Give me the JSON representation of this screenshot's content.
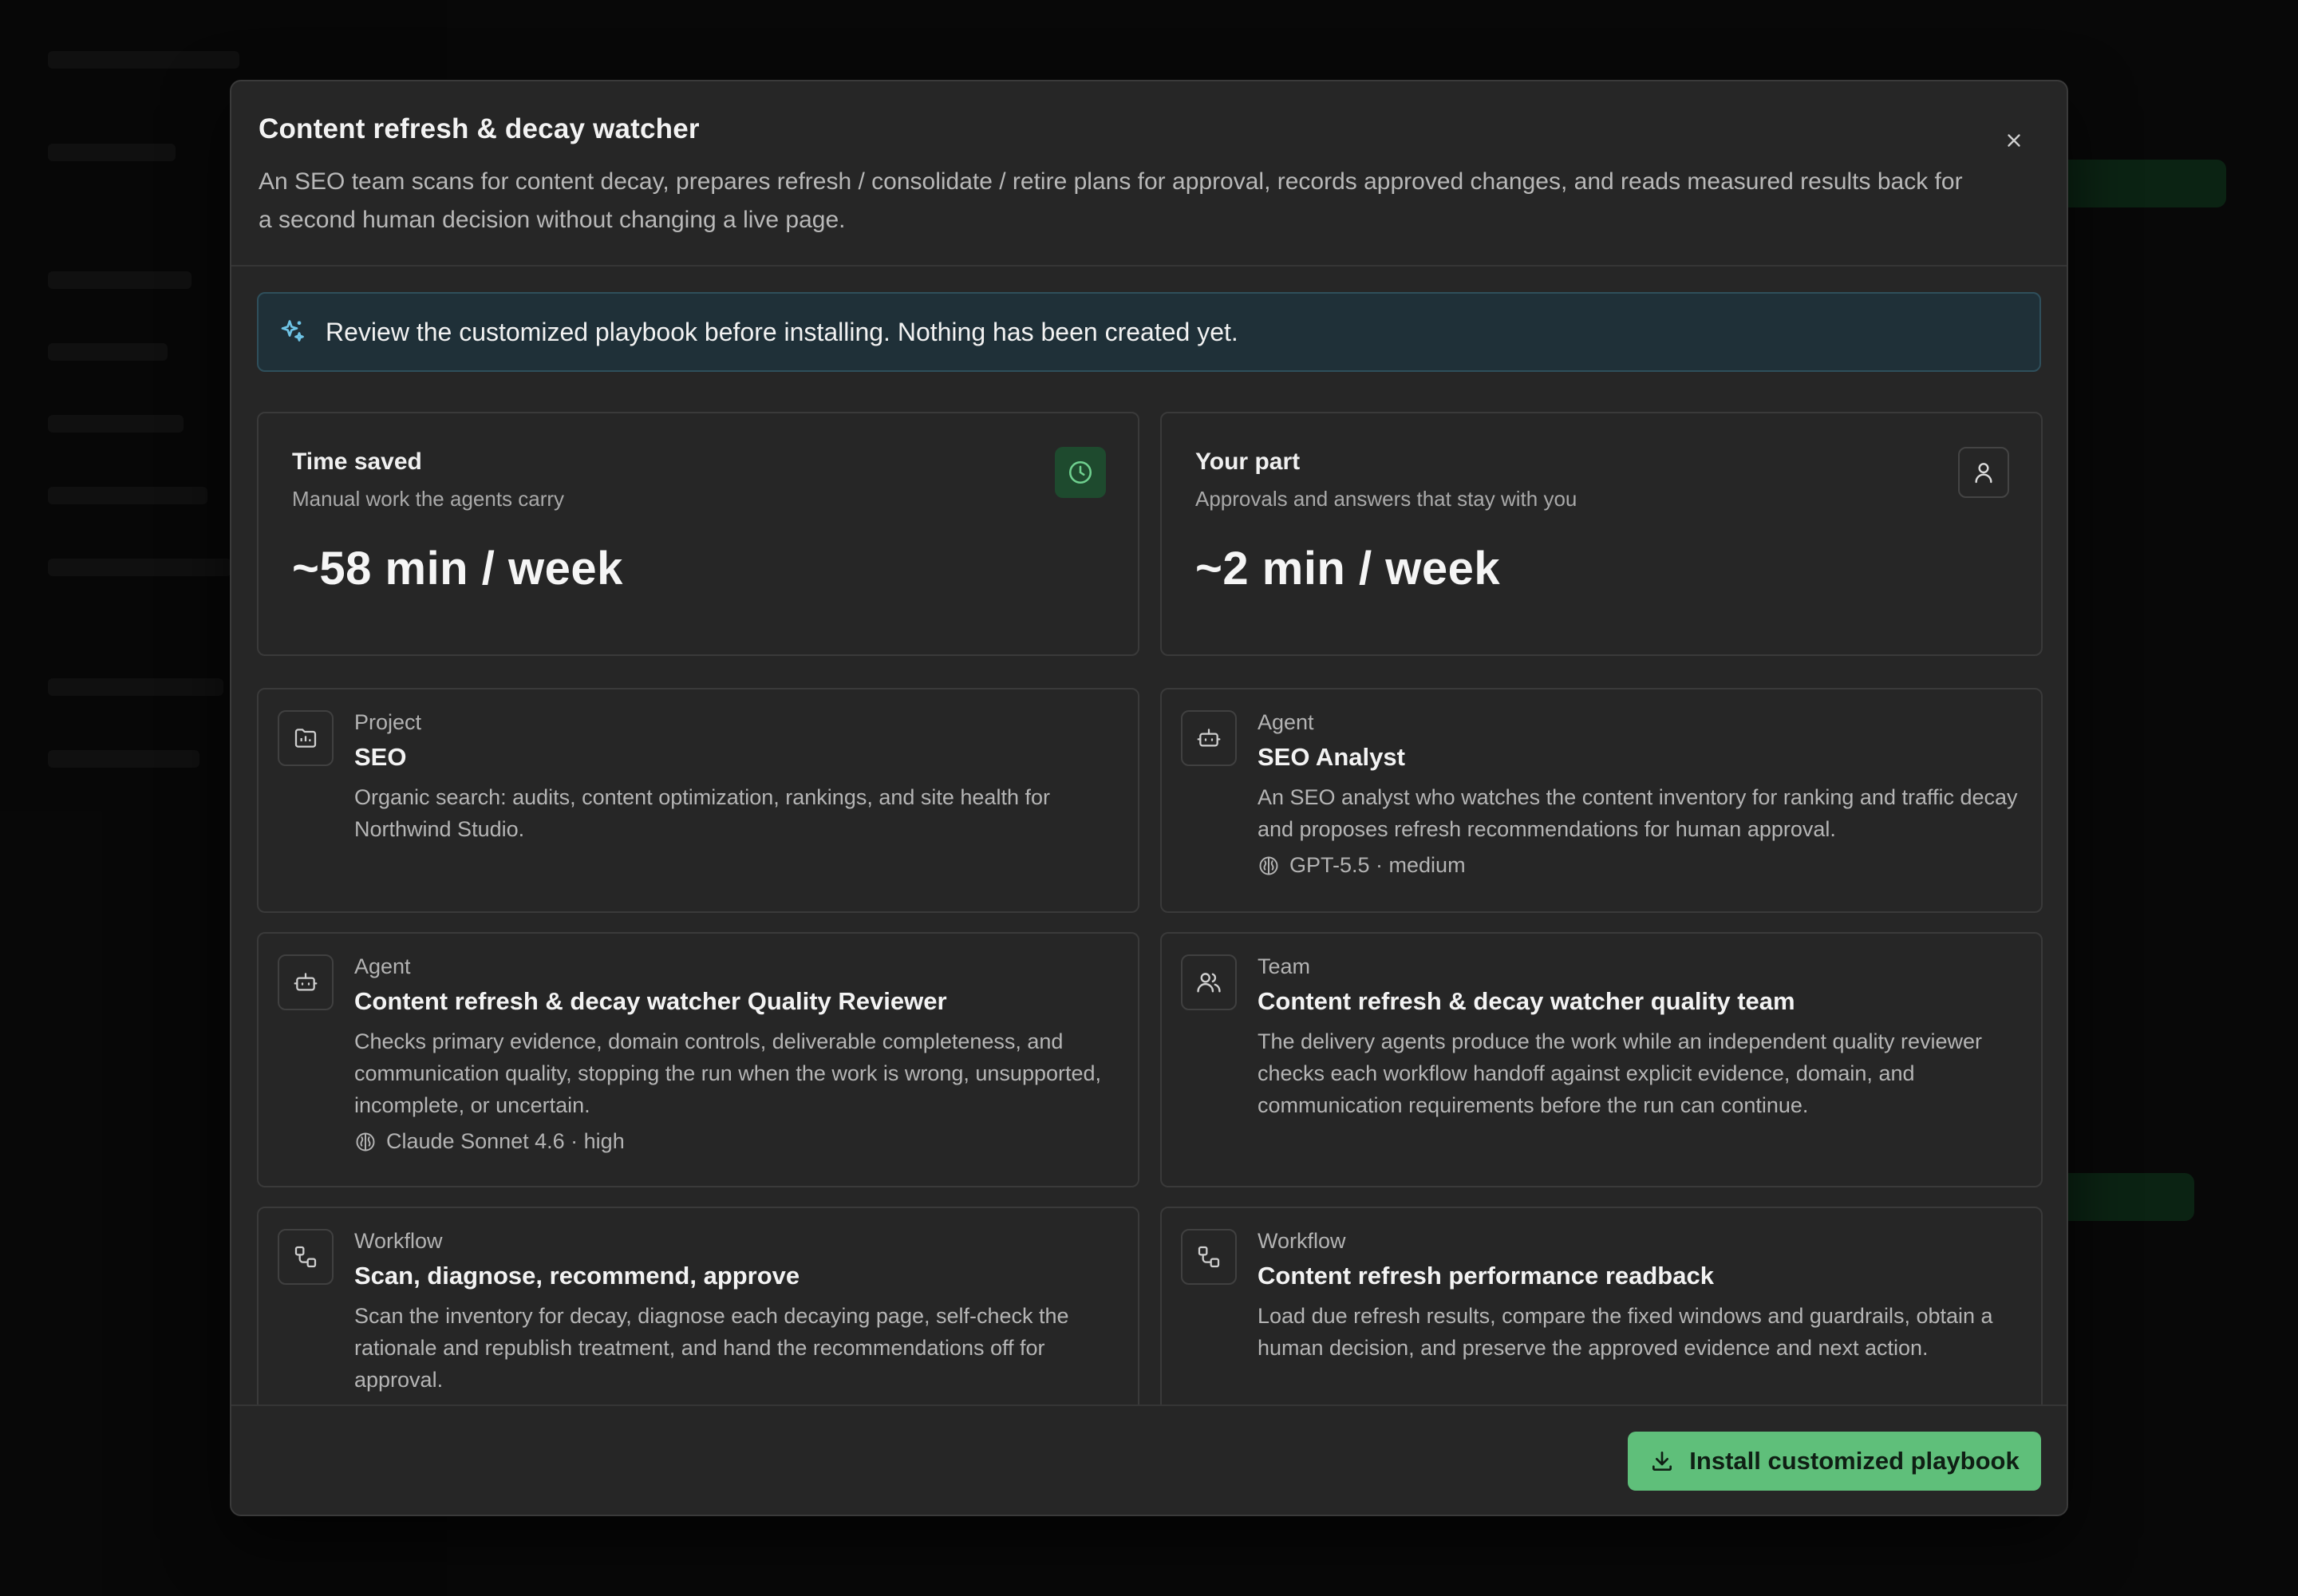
{
  "modal": {
    "title": "Content refresh & decay watcher",
    "description": "An SEO team scans for content decay, prepares refresh / consolidate / retire plans for approval, records approved changes, and reads measured results back for a second human decision without changing a live page.",
    "close_icon": "close-icon"
  },
  "notice": {
    "icon": "sparkles-icon",
    "text": "Review the customized playbook before installing. Nothing has been created yet."
  },
  "stats": [
    {
      "title": "Time saved",
      "subtitle": "Manual work the agents carry",
      "value": "~58 min / week",
      "icon": "clock-icon",
      "accent": "#6fd08f"
    },
    {
      "title": "Your part",
      "subtitle": "Approvals and answers that stay with you",
      "value": "~2 min / week",
      "icon": "user-icon"
    }
  ],
  "items": [
    {
      "kind": "Project",
      "name": "SEO",
      "description": "Organic search: audits, content optimization, rankings, and site health for Northwind Studio.",
      "icon": "folder-icon"
    },
    {
      "kind": "Agent",
      "name": "SEO Analyst",
      "description": "An SEO analyst who watches the content inventory for ranking and traffic decay and proposes refresh recommendations for human approval.",
      "model": "GPT-5.5 · medium",
      "icon": "bot-icon"
    },
    {
      "kind": "Agent",
      "name": "Content refresh & decay watcher Quality Reviewer",
      "description": "Checks primary evidence, domain controls, deliverable completeness, and communication quality, stopping the run when the work is wrong, unsupported, incomplete, or uncertain.",
      "model": "Claude Sonnet 4.6 · high",
      "icon": "bot-icon"
    },
    {
      "kind": "Team",
      "name": "Content refresh & decay watcher quality team",
      "description": "The delivery agents produce the work while an independent quality reviewer checks each workflow handoff against explicit evidence, domain, and communication requirements before the run can continue.",
      "icon": "users-icon"
    },
    {
      "kind": "Workflow",
      "name": "Scan, diagnose, recommend, approve",
      "description": "Scan the inventory for decay, diagnose each decaying page, self-check the rationale and republish treatment, and hand the recommendations off for approval.",
      "icon": "workflow-icon"
    },
    {
      "kind": "Workflow",
      "name": "Content refresh performance readback",
      "description": "Load due refresh results, compare the fixed windows and guardrails, obtain a human decision, and preserve the approved evidence and next action.",
      "icon": "workflow-icon"
    }
  ],
  "footer": {
    "install_label": "Install customized playbook",
    "install_icon": "download-icon",
    "button_color": "#5fbf7a"
  }
}
